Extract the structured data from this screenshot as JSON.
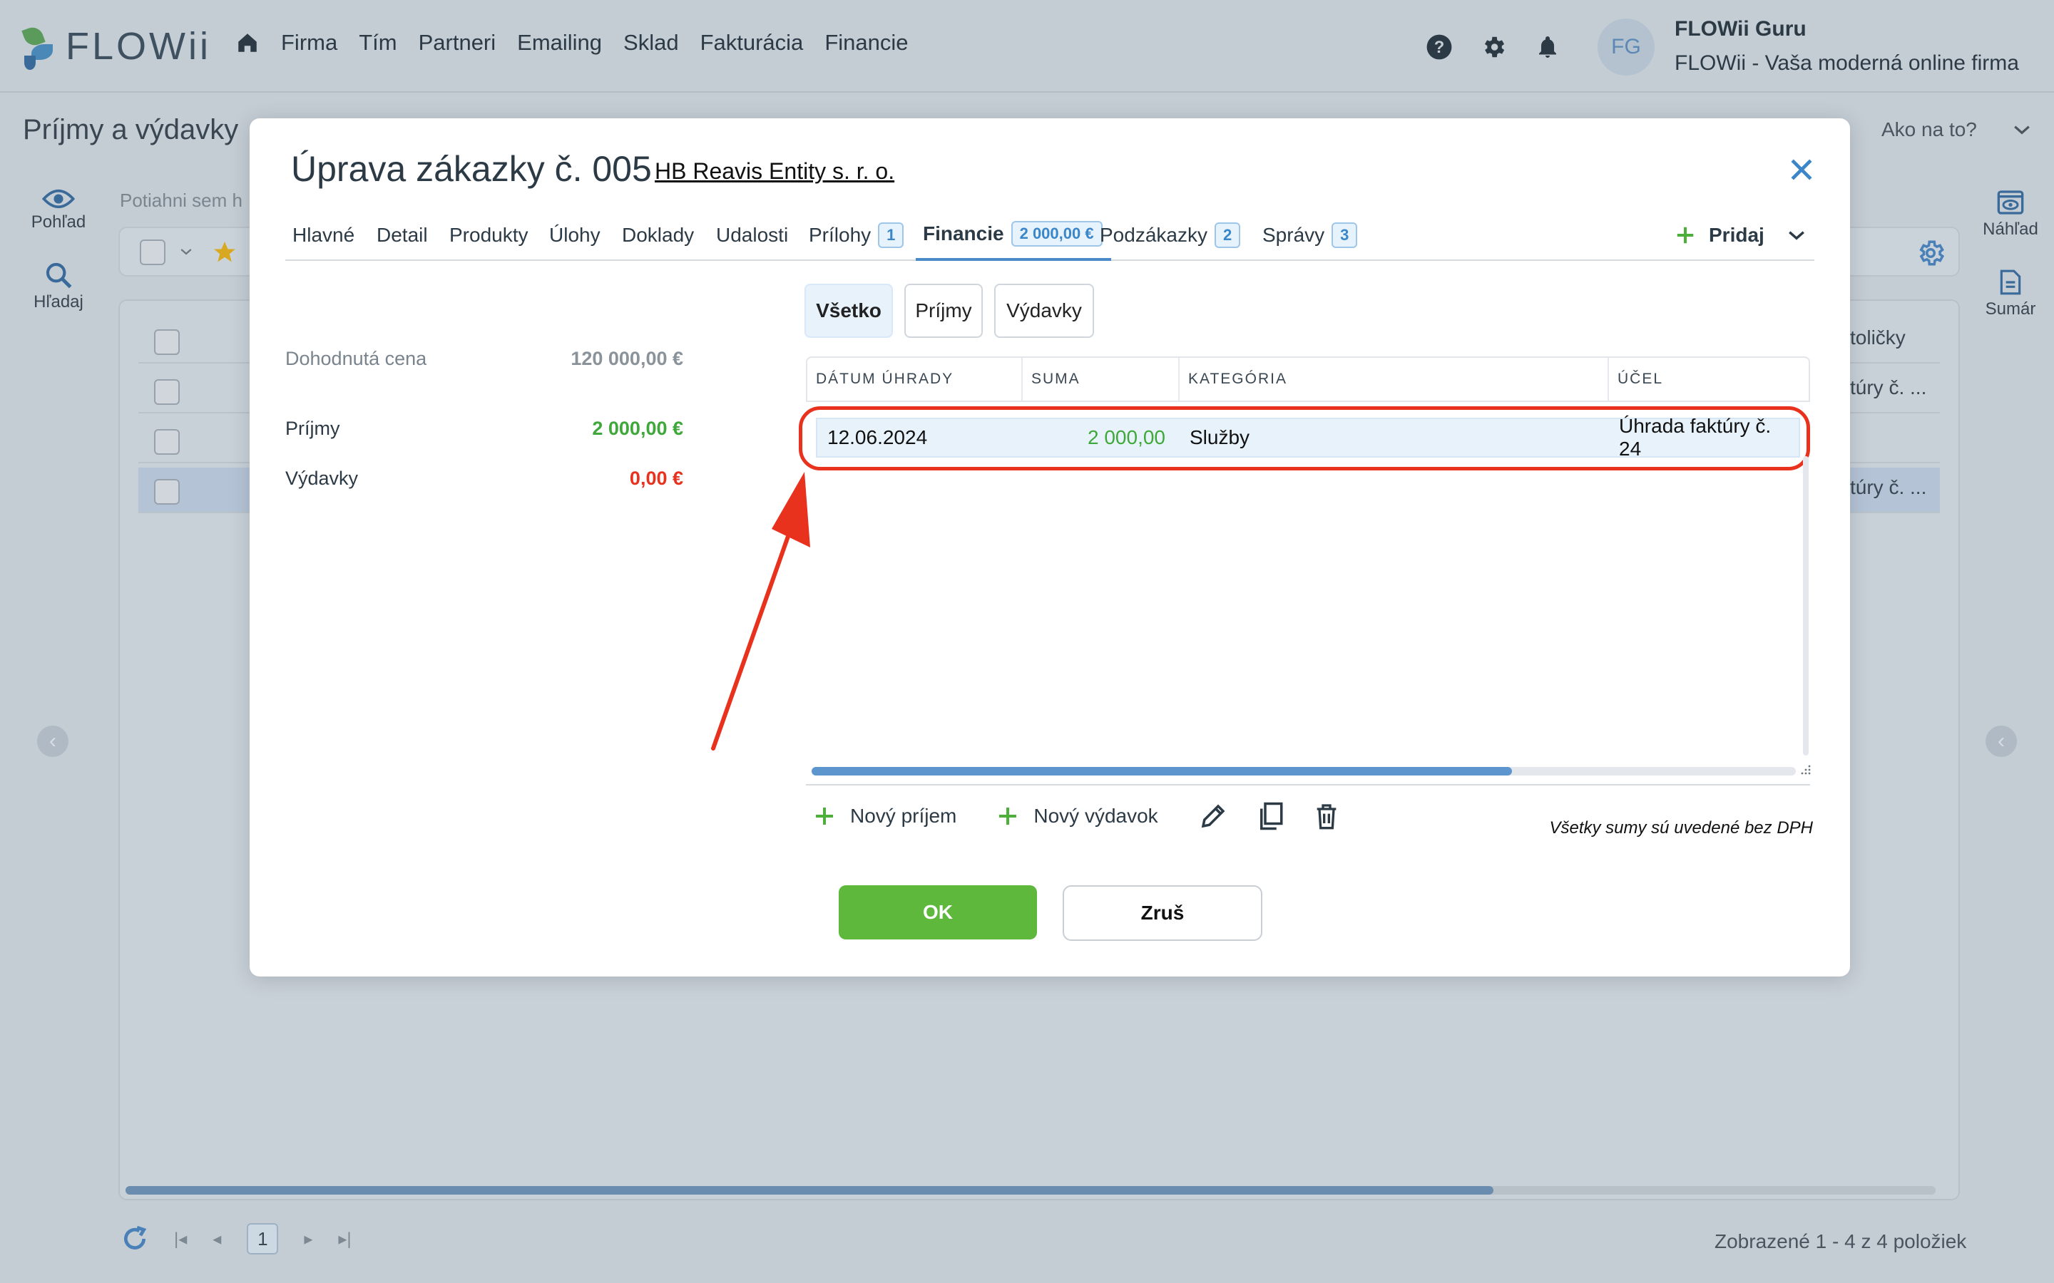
{
  "topbar": {
    "logo_text": "FLOWii",
    "nav": [
      "Firma",
      "Tím",
      "Partneri",
      "Emailing",
      "Sklad",
      "Fakturácia",
      "Financie"
    ],
    "avatar_initials": "FG",
    "user_name": "FLOWii Guru",
    "user_company": "FLOWii - Vaša moderná online firma"
  },
  "page": {
    "title": "Príjmy a výdavky",
    "help_label": "Ako na to?",
    "drag_hint": "Potiahni sem h",
    "left_rail": [
      {
        "label": "Pohľad",
        "icon": "eye-icon"
      },
      {
        "label": "Hľadaj",
        "icon": "search-icon"
      }
    ],
    "right_rail": [
      {
        "label": "Náhľad",
        "icon": "preview-icon"
      },
      {
        "label": "Sumár",
        "icon": "summary-icon"
      }
    ],
    "rows_right_text": [
      "toličky",
      "túry č. ...",
      "",
      "túry č. ..."
    ],
    "pager": {
      "current_page": "1"
    },
    "showing": "Zobrazené 1 - 4 z 4 položiek"
  },
  "modal": {
    "title": "Úprava zákazky č. 005",
    "company_link": "HB Reavis Entity s. r. o.",
    "tabs": [
      {
        "label": "Hlavné"
      },
      {
        "label": "Detail"
      },
      {
        "label": "Produkty"
      },
      {
        "label": "Úlohy"
      },
      {
        "label": "Doklady"
      },
      {
        "label": "Udalosti"
      },
      {
        "label": "Prílohy",
        "badge": "1"
      },
      {
        "label": "Financie",
        "badge": "2 000,00 €"
      },
      {
        "label": "Podzákazky",
        "badge": "2"
      },
      {
        "label": "Správy",
        "badge": "3"
      }
    ],
    "add_label": "Pridaj",
    "summary": {
      "agreed_label": "Dohodnutá cena",
      "agreed_value": "120 000,00 €",
      "income_label": "Príjmy",
      "income_value": "2 000,00 €",
      "expense_label": "Výdavky",
      "expense_value": "0,00 €"
    },
    "filters": [
      "Všetko",
      "Príjmy",
      "Výdavky"
    ],
    "grid": {
      "columns": [
        "DÁTUM ÚHRADY",
        "SUMA",
        "KATEGÓRIA",
        "ÚČEL"
      ],
      "rows": [
        {
          "date": "12.06.2024",
          "amount": "2 000,00",
          "category": "Služby",
          "purpose": "Úhrada faktúry č. 24"
        }
      ]
    },
    "actions": {
      "new_income": "Nový príjem",
      "new_expense": "Nový výdavok"
    },
    "note": "Všetky sumy sú uvedené bez DPH",
    "ok_label": "OK",
    "cancel_label": "Zruš"
  },
  "colors": {
    "accent_blue": "#4a8ac8",
    "income_green": "#3fa83a",
    "expense_red": "#e8321e",
    "ok_green": "#5eb83c",
    "annotation_red": "#e8321e"
  }
}
